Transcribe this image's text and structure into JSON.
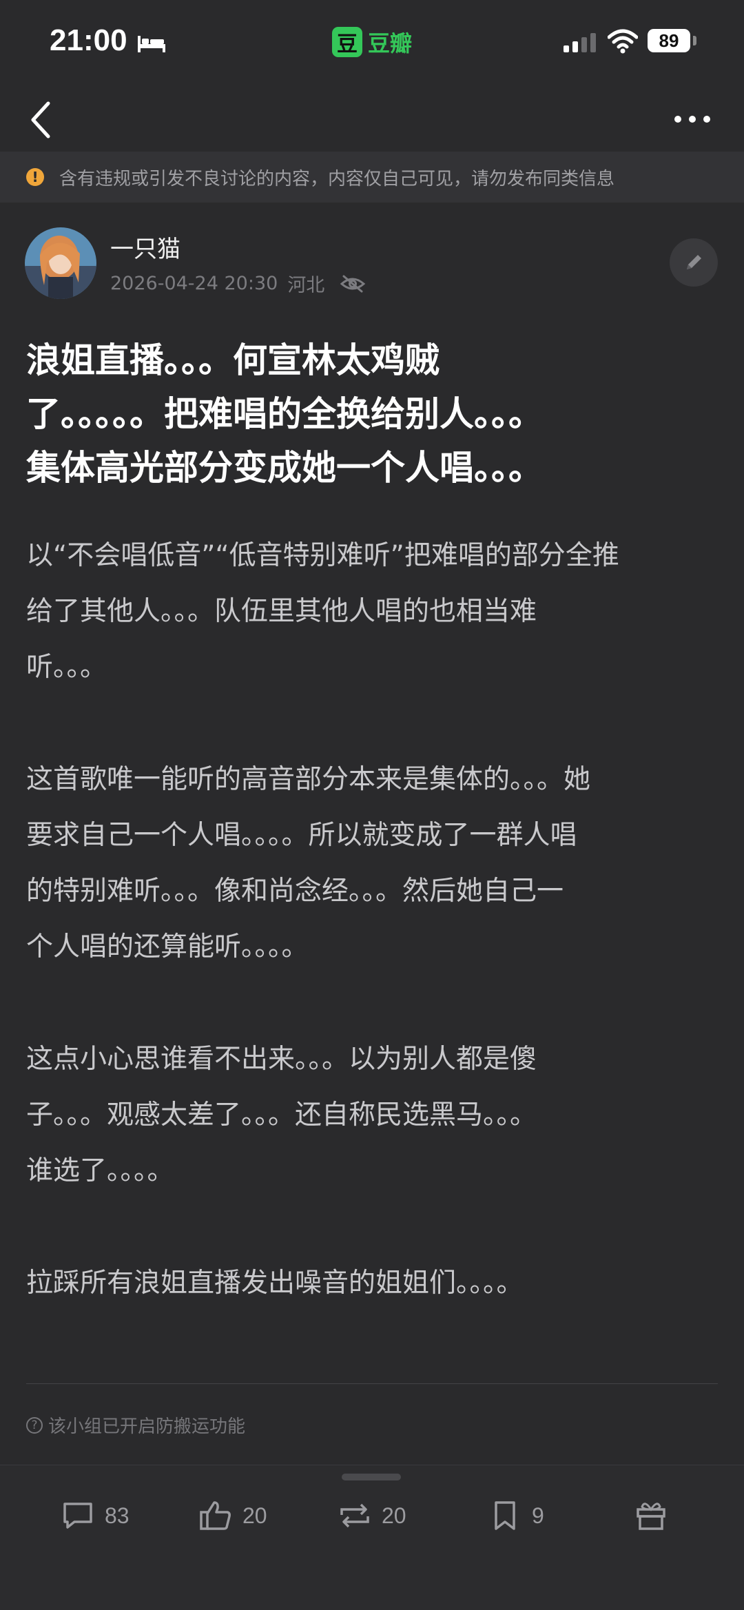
{
  "status_bar": {
    "time": "21:00",
    "app_name": "豆瓣",
    "app_logo_glyph": "豆",
    "battery": "89",
    "accent": "#34c759"
  },
  "nav": {
    "back_icon": "chevron-left-icon",
    "more_icon": "more-horizontal-icon"
  },
  "warning": {
    "icon": "!",
    "text": "含有违规或引发不良讨论的内容，内容仅自己可见，请勿发布同类信息",
    "icon_color": "#f0a63a"
  },
  "author": {
    "name": "一只猫",
    "timestamp": "2026-04-24 20:30",
    "location": "河北"
  },
  "post": {
    "title_lines": [
      "浪姐直播。。。何宣林太鸡贼",
      "了。。。。。把难唱的全换给别人。。。",
      "集体高光部分变成她一个人唱。。。"
    ],
    "paragraphs": [
      {
        "lines": [
          "以“不会唱低音”“低音特别难听”把难唱的部分全推",
          "给了其他人。。。队伍里其他人唱的也相当难",
          "听。。。"
        ]
      },
      {
        "lines": [
          "这首歌唯一能听的高音部分本来是集体的。。。她",
          "要求自己一个人唱。。。。所以就变成了一群人唱",
          "的特别难听。。。像和尚念经。。。然后她自己一",
          "个人唱的还算能听。。。。"
        ]
      },
      {
        "lines": [
          "这点小心思谁看不出来。。。以为别人都是傻",
          "子。。。观感太差了。。。还自称民选黑马。。。",
          "谁选了。。。。"
        ]
      },
      {
        "lines": [
          "拉踩所有浪姐直播发出噪音的姐姐们。。。。"
        ]
      }
    ]
  },
  "footer_note": {
    "icon": "?",
    "text": "该小组已开启防搬运功能"
  },
  "actions": {
    "comments": "83",
    "likes": "20",
    "reposts": "20",
    "saves": "9"
  }
}
